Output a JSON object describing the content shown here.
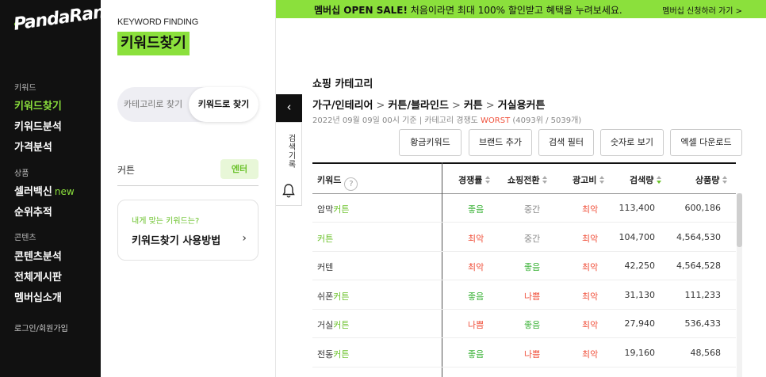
{
  "nav": {
    "logo": "PandaRank",
    "sections": [
      {
        "label": "키워드",
        "items": [
          {
            "label": "키워드찾기",
            "active": true
          },
          {
            "label": "키워드분석"
          },
          {
            "label": "가격분석"
          }
        ]
      },
      {
        "label": "상품",
        "items": [
          {
            "label": "셀러백신",
            "badge": "new"
          },
          {
            "label": "순위추적"
          }
        ]
      },
      {
        "label": "콘텐츠",
        "items": [
          {
            "label": "콘텐츠분석"
          },
          {
            "label": "전체게시판"
          },
          {
            "label": "멤버십소개"
          }
        ]
      }
    ],
    "login": "로그인/회원가입"
  },
  "panel": {
    "title_en": "KEYWORD FINDING",
    "title_ko": "키워드찾기",
    "seg_category": "카테고리로 찾기",
    "seg_keyword": "키워드로 찾기",
    "input_value": "커튼",
    "enter_label": "엔터",
    "howto_question": "내게 맞는 키워드는?",
    "howto_title": "키워드찾기 사용방법"
  },
  "side": {
    "collapse": "‹",
    "history": "검색기록"
  },
  "banner": {
    "bold": "멤버십 OPEN SALE!",
    "text": " 처음이라면 최대 100% 할인받고 혜택을 누려보세요.",
    "link": "멤버십 신청하러 가기 >"
  },
  "content": {
    "category_title": "쇼핑 카테고리",
    "breadcrumb": [
      "가구/인테리어",
      "커튼/블라인드",
      "커튼",
      "거실용커튼"
    ],
    "breadcrumb_sep": ">",
    "meta_prefix": "2022년 09월 09일 00시 기준  |  카테고리 경쟁도 ",
    "meta_worst": "WORST",
    "meta_suffix": " (4093위 / 5039개)",
    "buttons": [
      "황금키워드",
      "브랜드 추가",
      "검색 필터",
      "숫자로 보기",
      "엑셀 다운로드"
    ]
  },
  "table": {
    "headers": {
      "keyword": "키워드",
      "help": "?",
      "competition": "경쟁률",
      "conversion": "쇼핑전환",
      "ad_cost": "광고비",
      "search": "검색량",
      "products": "상품량"
    },
    "rows": [
      {
        "pre": "암막",
        "hl": "커튼",
        "post": "",
        "competition": "좋음",
        "conversion": "중간",
        "ad_cost": "최악",
        "search": "113,400",
        "products": "600,186"
      },
      {
        "pre": "",
        "hl": "커튼",
        "post": "",
        "competition": "최악",
        "conversion": "중간",
        "ad_cost": "최악",
        "search": "104,700",
        "products": "4,564,530"
      },
      {
        "pre": "커텐",
        "hl": "",
        "post": "",
        "competition": "최악",
        "conversion": "좋음",
        "ad_cost": "최악",
        "search": "42,250",
        "products": "4,564,528"
      },
      {
        "pre": "쉬폰",
        "hl": "커튼",
        "post": "",
        "competition": "좋음",
        "conversion": "나쁨",
        "ad_cost": "최악",
        "search": "31,130",
        "products": "111,233"
      },
      {
        "pre": "거실",
        "hl": "커튼",
        "post": "",
        "competition": "나쁨",
        "conversion": "좋음",
        "ad_cost": "최악",
        "search": "27,940",
        "products": "536,433"
      },
      {
        "pre": "전동",
        "hl": "커튼",
        "post": "",
        "competition": "좋음",
        "conversion": "나쁨",
        "ad_cost": "최악",
        "search": "19,160",
        "products": "48,568"
      }
    ]
  },
  "colors": {
    "accent": "#8be03c",
    "good": "#3db33a",
    "bad": "#f0523d"
  }
}
